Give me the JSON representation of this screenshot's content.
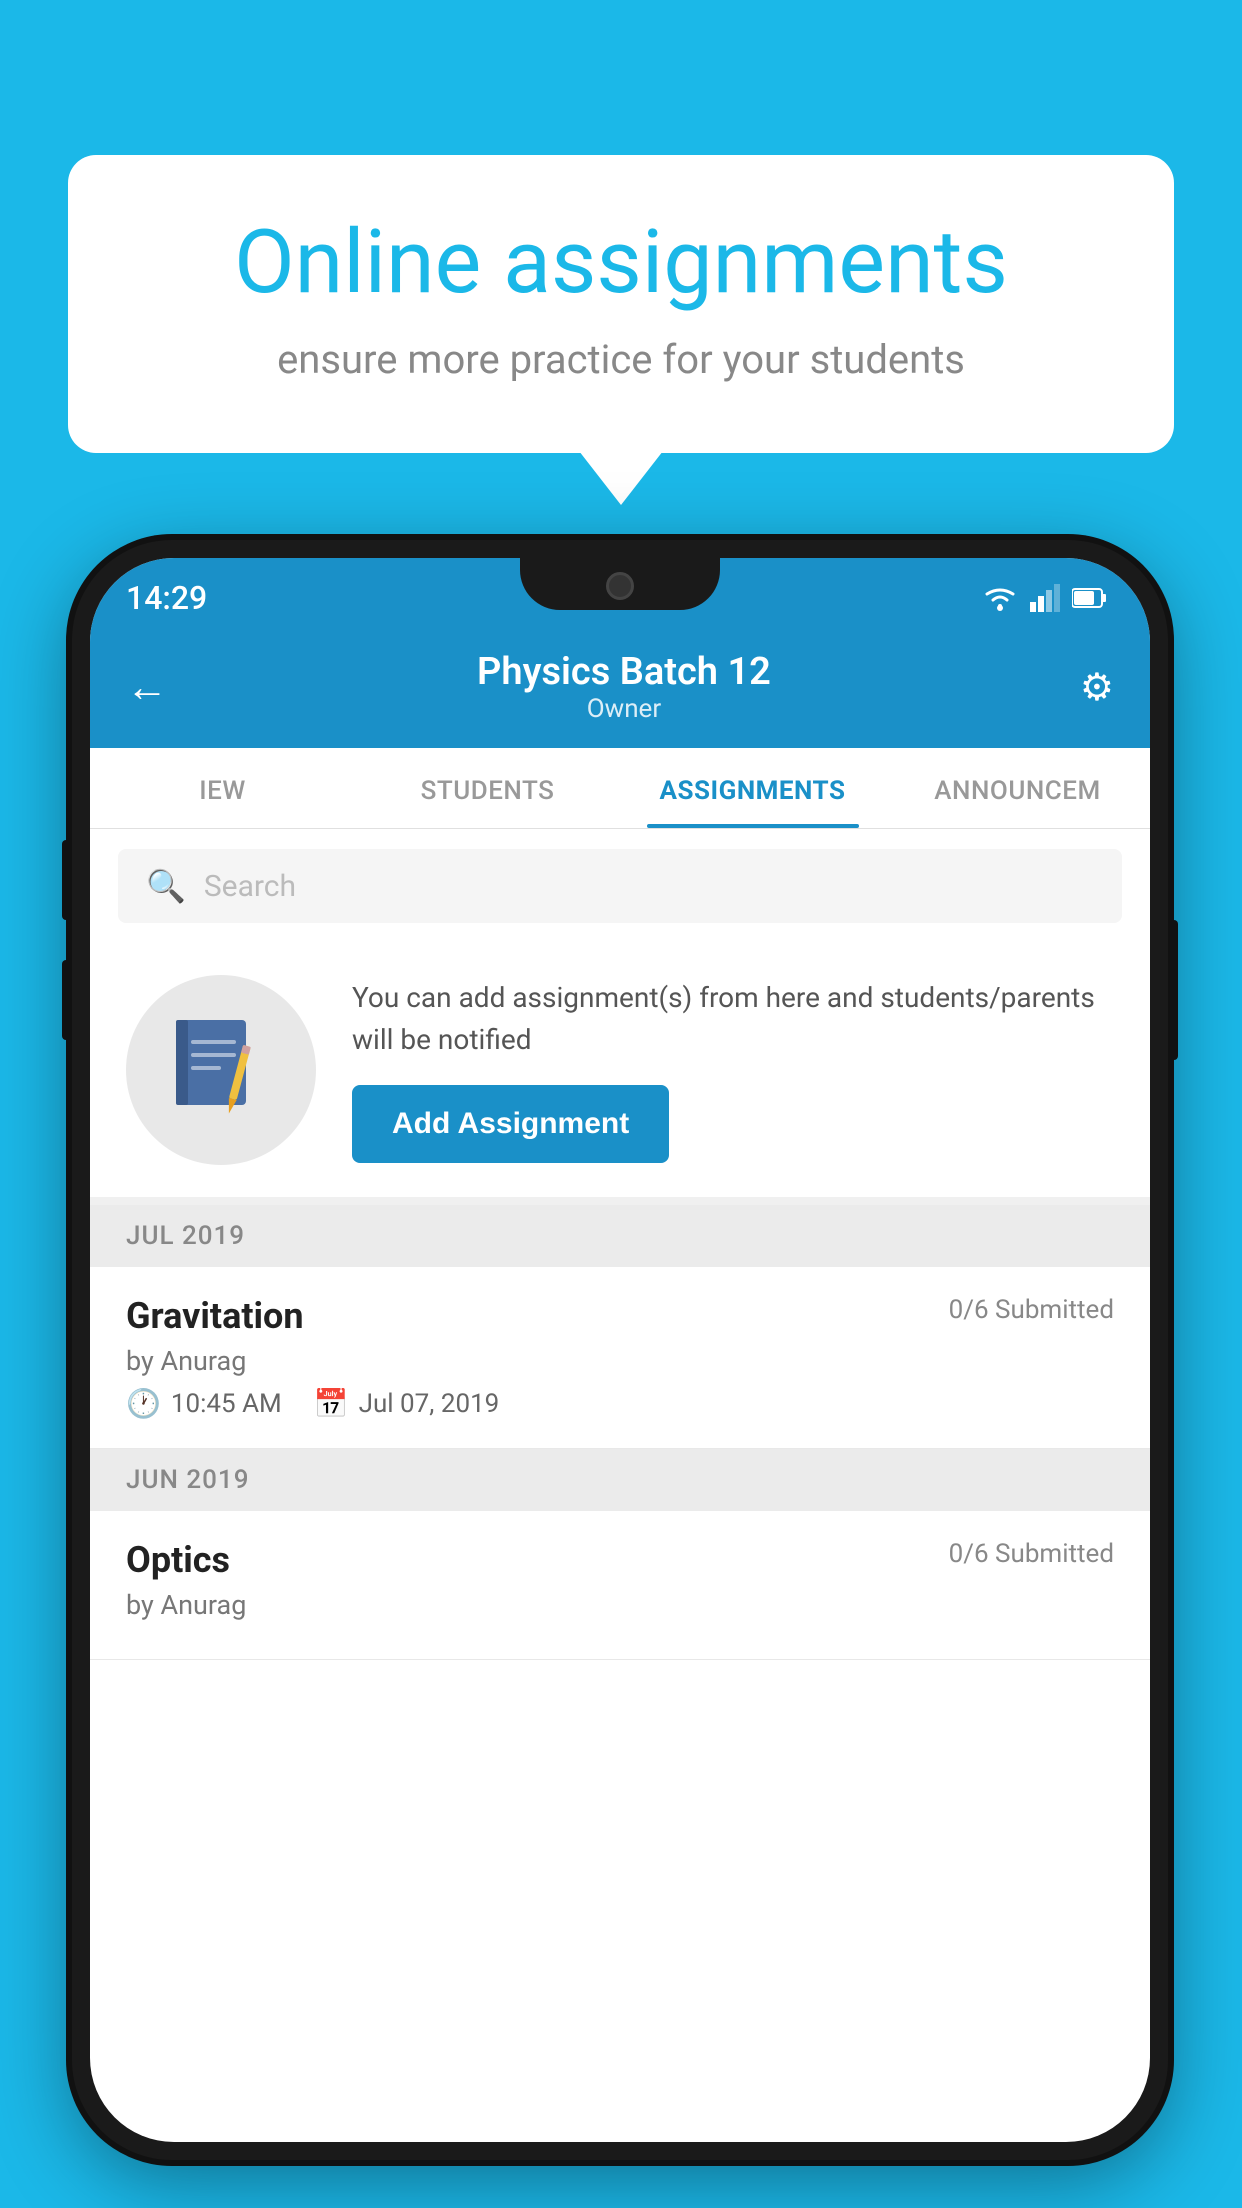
{
  "background_color": "#1BB8E8",
  "speech_bubble": {
    "title": "Online assignments",
    "subtitle": "ensure more practice for your students"
  },
  "phone": {
    "status_bar": {
      "time": "14:29"
    },
    "header": {
      "title": "Physics Batch 12",
      "subtitle": "Owner",
      "back_label": "←",
      "settings_label": "⚙"
    },
    "tabs": [
      {
        "label": "IEW",
        "active": false
      },
      {
        "label": "STUDENTS",
        "active": false
      },
      {
        "label": "ASSIGNMENTS",
        "active": true
      },
      {
        "label": "ANNOUNCEM",
        "active": false
      }
    ],
    "search": {
      "placeholder": "Search"
    },
    "promo": {
      "text": "You can add assignment(s) from here and students/parents will be notified",
      "button_label": "Add Assignment"
    },
    "sections": [
      {
        "month": "JUL 2019",
        "assignments": [
          {
            "name": "Gravitation",
            "submitted": "0/6 Submitted",
            "by": "by Anurag",
            "time": "10:45 AM",
            "date": "Jul 07, 2019"
          }
        ]
      },
      {
        "month": "JUN 2019",
        "assignments": [
          {
            "name": "Optics",
            "submitted": "0/6 Submitted",
            "by": "by Anurag",
            "time": "",
            "date": ""
          }
        ]
      }
    ]
  }
}
